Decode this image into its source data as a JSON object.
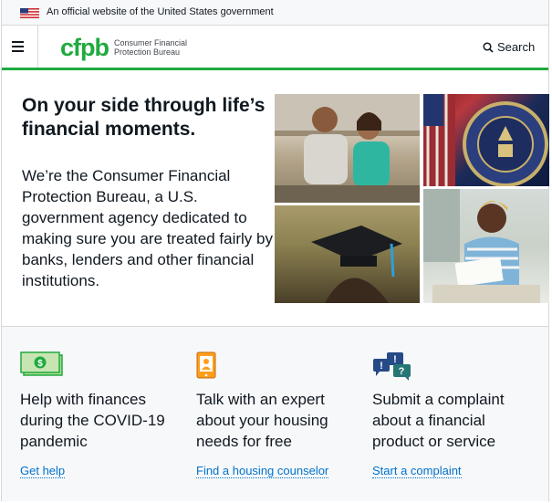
{
  "gov_banner": {
    "text": "An official website of the United States government"
  },
  "header": {
    "logo_mark": "cfpb",
    "logo_line1": "Consumer Financial",
    "logo_line2": "Protection Bureau",
    "search_label": "Search"
  },
  "hero": {
    "title": "On your side through life’s financial moments.",
    "body": "We’re the Consumer Financial Protection Bureau, a U.S. government agency dedicated to making sure you are treated fairly by banks, lenders and other financial institutions."
  },
  "actions": [
    {
      "icon": "money-icon",
      "title": "Help with finances during the COVID-19 pandemic",
      "link": "Get help"
    },
    {
      "icon": "phone-person-icon",
      "title": "Talk with an expert about your housing needs for free",
      "link": "Find a housing counselor"
    },
    {
      "icon": "speech-bubbles-icon",
      "title": "Submit a complaint about a financial product or service",
      "link": "Start a complaint"
    }
  ],
  "colors": {
    "brand_green": "#20aa3f",
    "link_blue": "#0072ce",
    "text": "#101820",
    "icon_orange": "#ff9e1b",
    "icon_navy": "#254b87",
    "icon_teal": "#257675"
  }
}
